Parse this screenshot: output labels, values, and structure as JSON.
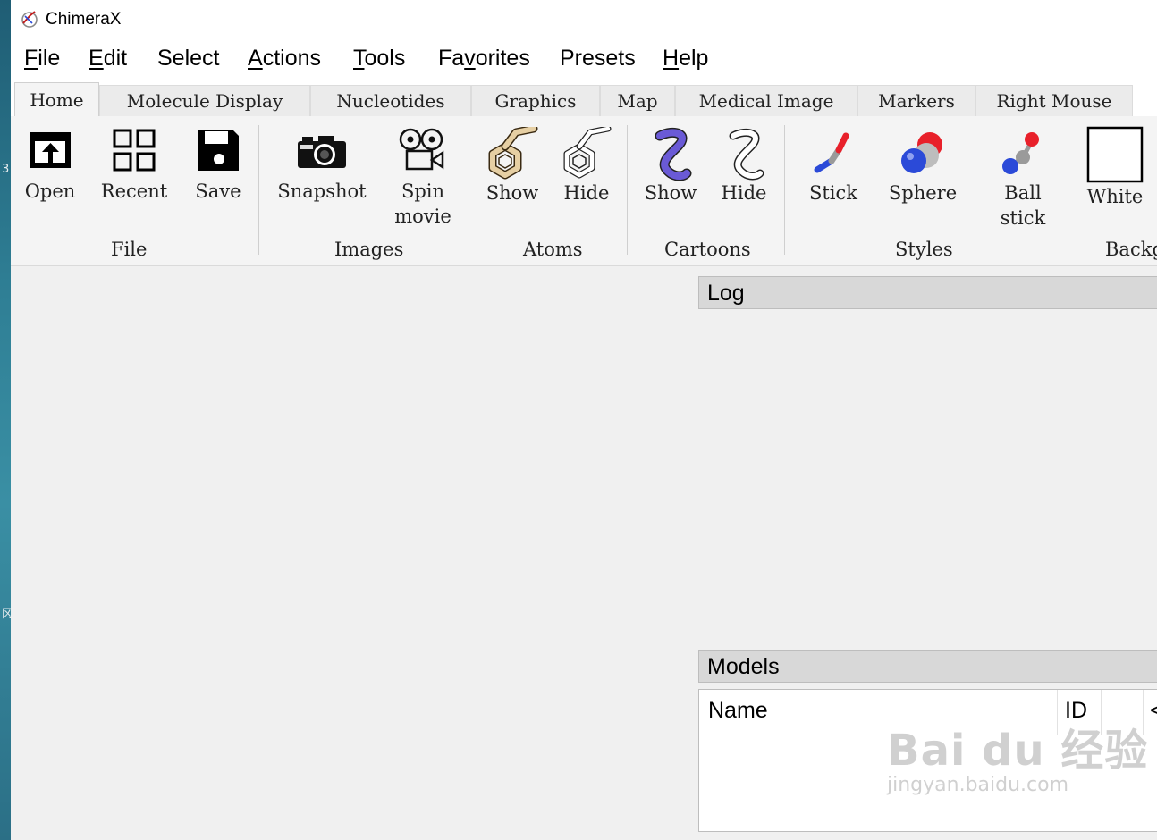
{
  "desktop": {
    "glyph_top": "3",
    "glyph_mid": "冈"
  },
  "window": {
    "title": "ChimeraX"
  },
  "menu": [
    {
      "mn": "F",
      "rest": "ile"
    },
    {
      "mn": "E",
      "rest": "dit"
    },
    {
      "pre": "Select"
    },
    {
      "mn": "A",
      "rest": "ctions"
    },
    {
      "mn": "T",
      "rest": "ools"
    },
    {
      "pre": "Fa",
      "mn": "v",
      "rest": "orites"
    },
    {
      "pre": "Presets"
    },
    {
      "mn": "H",
      "rest": "elp"
    }
  ],
  "tabs": [
    "Home",
    "Molecule Display",
    "Nucleotides",
    "Graphics",
    "Map",
    "Medical Image",
    "Markers",
    "Right Mouse"
  ],
  "ribbon": {
    "buttons": {
      "open": "Open",
      "recent": "Recent",
      "save": "Save",
      "snapshot": "Snapshot",
      "spin": "Spin\nmovie",
      "atoms_show": "Show",
      "atoms_hide": "Hide",
      "cartoons_show": "Show",
      "cartoons_hide": "Hide",
      "stick": "Stick",
      "sphere": "Sphere",
      "ballstick": "Ball\nstick",
      "white": "White"
    },
    "groups": {
      "file": "File",
      "images": "Images",
      "atoms": "Atoms",
      "cartoons": "Cartoons",
      "styles": "Styles",
      "background": "Backg"
    }
  },
  "log": {
    "title": "Log"
  },
  "models": {
    "title": "Models",
    "columns": {
      "name": "Name",
      "id": "ID",
      "extra": "<"
    }
  },
  "watermark": {
    "main": "Bai du 经验",
    "sub": "jingyan.baidu.com"
  },
  "colors": {
    "cartoon_purple": "#6a5ad6",
    "atom_tan": "#e6cfa3",
    "oxygen": "#e8202a",
    "nitrogen": "#2b4ad8",
    "carbon": "#9a9a9a"
  }
}
